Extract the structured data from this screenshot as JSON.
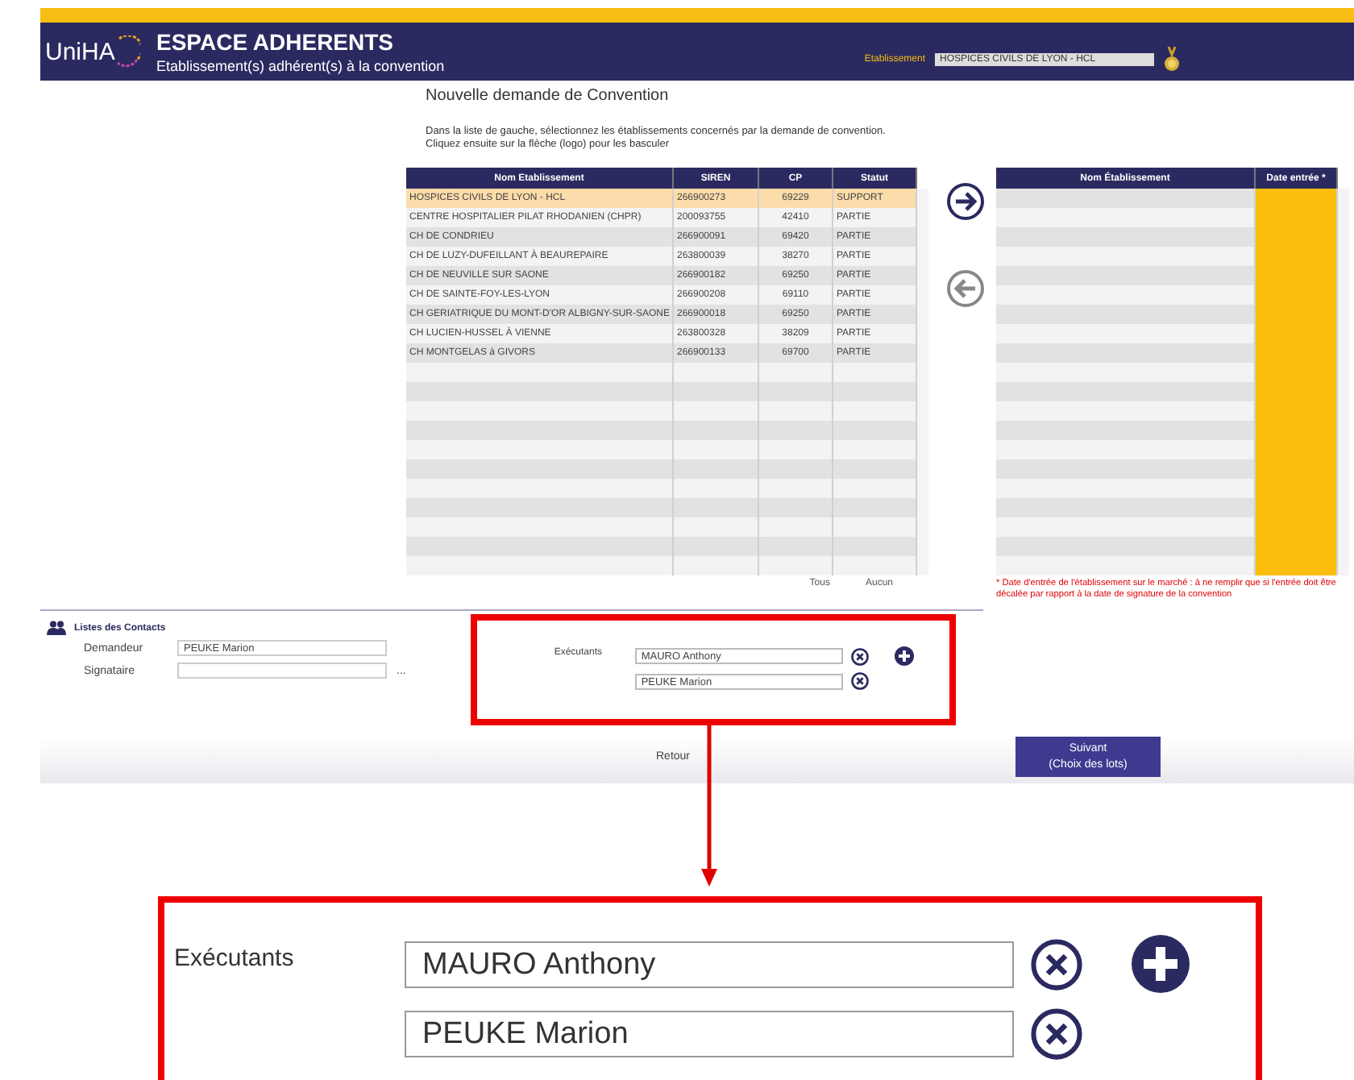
{
  "header": {
    "logo": "UniHA",
    "title": "ESPACE ADHERENTS",
    "subtitle": "Etablissement(s) adhérent(s) à la convention",
    "establishment_label": "Etablissement",
    "establishment_value": "HOSPICES CIVILS DE LYON - HCL"
  },
  "page_title": "Nouvelle demande de Convention",
  "instructions": [
    "Dans la liste de gauche, sélectionnez les établissements concernés par la demande de convention.",
    "Cliquez ensuite sur la flèche (logo) pour les basculer"
  ],
  "available_table": {
    "columns": [
      "Nom Etablissement",
      "SIREN",
      "CP",
      "Statut"
    ],
    "rows": [
      {
        "cells": [
          "HOSPICES CIVILS DE LYON - HCL",
          "266900273",
          "69229",
          "SUPPORT"
        ],
        "selected": true
      },
      {
        "cells": [
          "CENTRE HOSPITALIER PILAT RHODANIEN (CHPR)",
          "200093755",
          "42410",
          "PARTIE"
        ],
        "selected": false
      },
      {
        "cells": [
          "CH DE CONDRIEU",
          "266900091",
          "69420",
          "PARTIE"
        ],
        "selected": false
      },
      {
        "cells": [
          "CH DE LUZY-DUFEILLANT À BEAUREPAIRE",
          "263800039",
          "38270",
          "PARTIE"
        ],
        "selected": false
      },
      {
        "cells": [
          "CH DE NEUVILLE SUR SAONE",
          "266900182",
          "69250",
          "PARTIE"
        ],
        "selected": false
      },
      {
        "cells": [
          "CH DE SAINTE-FOY-LES-LYON",
          "266900208",
          "69110",
          "PARTIE"
        ],
        "selected": false
      },
      {
        "cells": [
          "CH GERIATRIQUE DU MONT-D'OR ALBIGNY-SUR-SAONE",
          "266900018",
          "69250",
          "PARTIE"
        ],
        "selected": false
      },
      {
        "cells": [
          "CH LUCIEN-HUSSEL À VIENNE",
          "263800328",
          "38209",
          "PARTIE"
        ],
        "selected": false
      },
      {
        "cells": [
          "CH MONTGELAS à GIVORS",
          "266900133",
          "69700",
          "PARTIE"
        ],
        "selected": false
      }
    ]
  },
  "select_links": [
    "Tous",
    "Aucun"
  ],
  "selected_table": {
    "columns": [
      "Nom Établissement",
      "Date entrée *"
    ]
  },
  "date_note": "* Date d'entrée de l'établissement sur le marché : à ne remplir que si l'entrée doit être décalée par rapport à la date de signature de la convention",
  "contacts": {
    "title": "Listes des Contacts",
    "demandeur": {
      "label": "Demandeur",
      "value": "PEUKE Marion"
    },
    "signataire": {
      "label": "Signataire",
      "more": "..."
    },
    "executants": {
      "label": "Exécutants",
      "values": [
        "MAURO Anthony",
        "PEUKE Marion"
      ]
    }
  },
  "footer": {
    "back": "Retour",
    "next": "Suivant\n(Choix des lots)"
  },
  "callout": {
    "label": "Exécutants",
    "values": [
      "MAURO Anthony",
      "PEUKE Marion"
    ]
  }
}
